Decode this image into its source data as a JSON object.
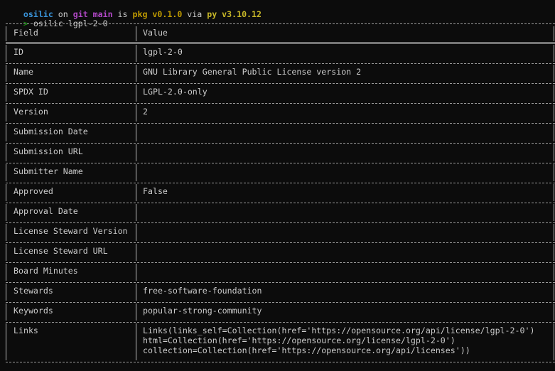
{
  "prompt": {
    "dir": "osilic",
    "on": " on ",
    "git_label": "git main",
    "is": " is ",
    "pkg_label": "pkg v0.1.0",
    "via": " via ",
    "py_label": "py v3.10.12",
    "symbol": ">",
    "command": "osilic lgpl-2-0"
  },
  "table": {
    "headers": {
      "field": "Field",
      "value": "Value"
    },
    "rows": [
      {
        "field": "ID",
        "value": "lgpl-2-0"
      },
      {
        "field": "Name",
        "value": "GNU Library General Public License version 2"
      },
      {
        "field": "SPDX ID",
        "value": "LGPL-2.0-only"
      },
      {
        "field": "Version",
        "value": "2"
      },
      {
        "field": "Submission Date",
        "value": ""
      },
      {
        "field": "Submission URL",
        "value": ""
      },
      {
        "field": "Submitter Name",
        "value": ""
      },
      {
        "field": "Approved",
        "value": "False"
      },
      {
        "field": "Approval Date",
        "value": ""
      },
      {
        "field": "License Steward Version",
        "value": ""
      },
      {
        "field": "License Steward URL",
        "value": ""
      },
      {
        "field": "Board Minutes",
        "value": ""
      },
      {
        "field": "Stewards",
        "value": "free-software-foundation"
      },
      {
        "field": "Keywords",
        "value": "popular-strong-community"
      },
      {
        "field": "Links",
        "value": "Links(links_self=Collection(href='https://opensource.org/api/license/lgpl-2-0')",
        "value_line2": "html=Collection(href='https://opensource.org/license/lgpl-2-0')",
        "value_line3": "collection=Collection(href='https://opensource.org/api/licenses'))"
      }
    ]
  },
  "colors": {
    "background": "#0c0c0c",
    "dir": "#3a96dd",
    "git": "#b148c6",
    "pkg": "#c19c00",
    "prompt_symbol": "#13a10e"
  }
}
